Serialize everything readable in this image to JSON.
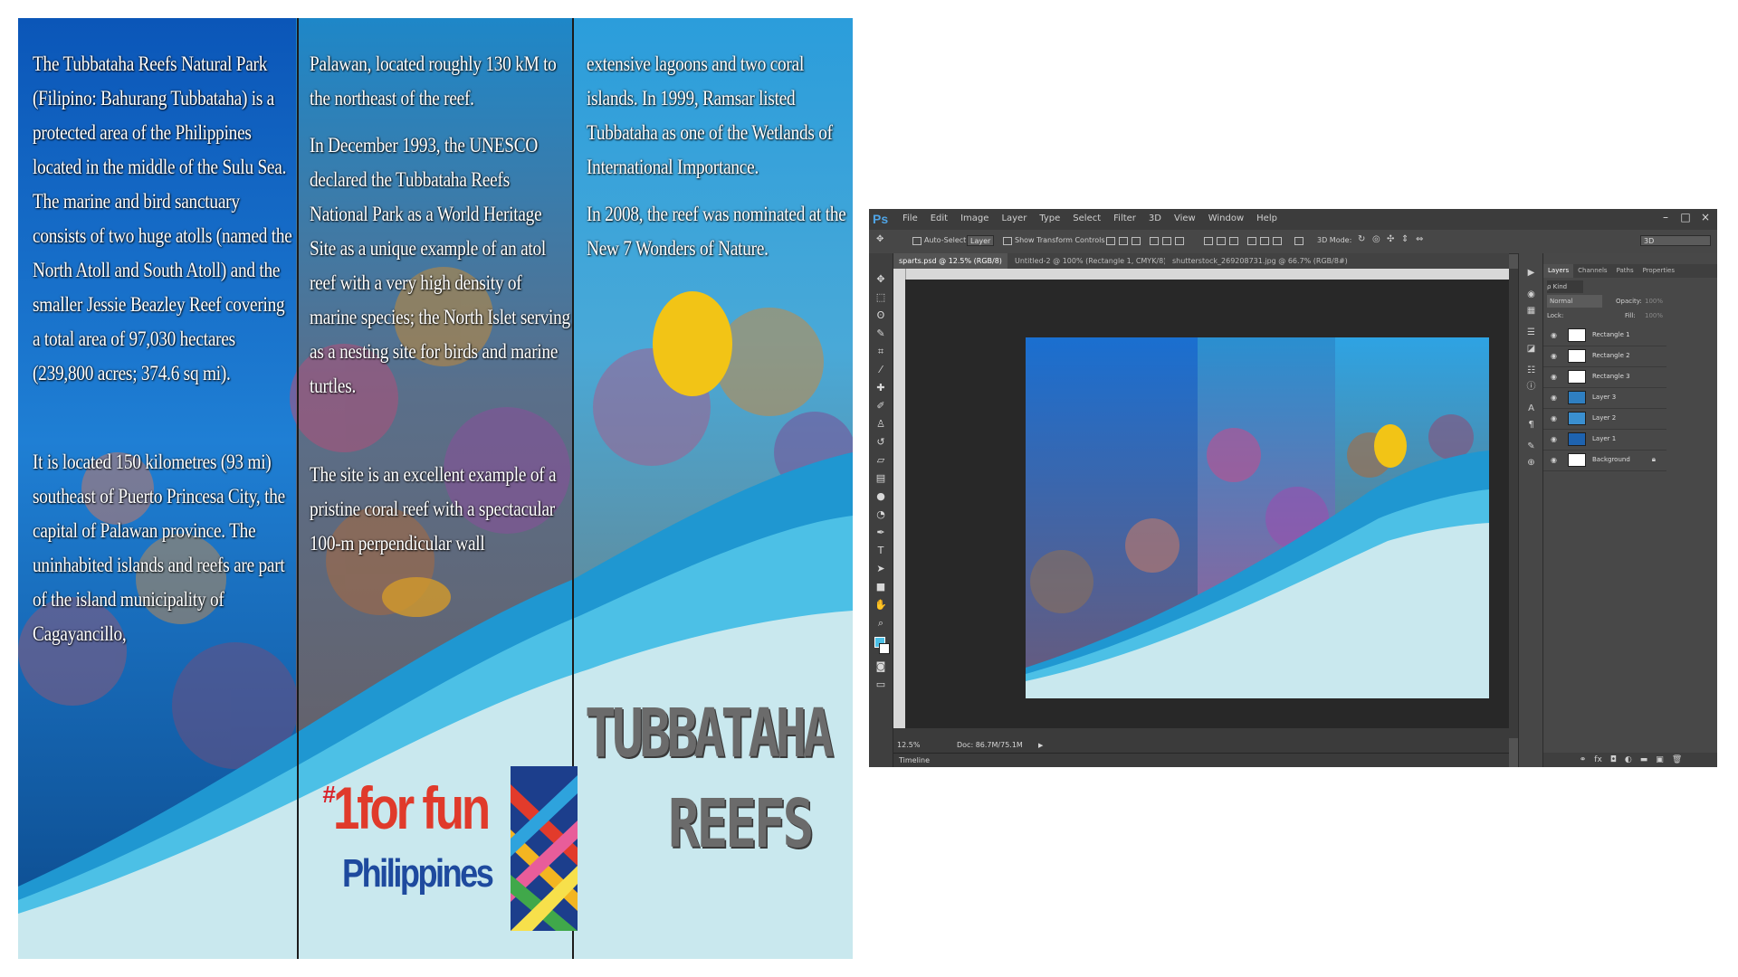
{
  "brochure": {
    "panel1": {
      "para1": "The Tubbataha Reefs Natural Park (Filipino: Bahurang Tubbataha) is a protected area of the Philippines located in the middle of the Sulu Sea. The marine and bird sanctuary consists of two huge atolls (named the North Atoll and South Atoll) and the smaller Jessie Beazley Reef covering a total area of 97,030 hectares (239,800 acres; 374.6 sq mi).",
      "para2": "It is located 150 kilometres (93 mi) southeast of Puerto Princesa City, the capital of Palawan province. The uninhabited islands and reefs are part of the island municipality of Cagayancillo,"
    },
    "panel2": {
      "para1": "Palawan, located roughly 130 kM to the northeast of the reef.",
      "para2": "In December 1993, the UNESCO declared the Tubbataha Reefs National Park as a World Heritage Site as a unique example of an atol reef with a very high density of marine species; the North Islet serving as a nesting site for birds and marine turtles.",
      "para3": "The site is an excellent example of a pristine coral reef with a spectacular 100-m perpendicular wall"
    },
    "panel3": {
      "para1": "extensive lagoons and two coral islands. In 1999, Ramsar listed Tubbataha as one of the Wetlands of International Importance.",
      "para2": "In 2008, the reef was nominated at the New 7 Wonders of Nature.",
      "title_line1": "TUBBATAHA",
      "title_line2": "REEFS"
    },
    "logo": {
      "hash": "#",
      "line1": "1for fun",
      "line2": "Philippines"
    }
  },
  "photoshop": {
    "app_logo": "Ps",
    "menu": [
      "File",
      "Edit",
      "Image",
      "Layer",
      "Type",
      "Select",
      "Filter",
      "3D",
      "View",
      "Window",
      "Help"
    ],
    "window_buttons": [
      "–",
      "□",
      "×"
    ],
    "options_bar": {
      "auto_select": "Auto-Select:",
      "auto_select_value": "Layer",
      "show_transform": "Show Transform Controls",
      "mode_3d": "3D Mode:",
      "workspace": "3D"
    },
    "tabs": [
      "sparts.psd @ 12.5% (RGB/8)",
      "Untitled-2 @ 100% (Rectangle 1, CMYK/8)",
      "shutterstock_269208731.jpg @ 66.7% (RGB/8#)"
    ],
    "status": {
      "zoom": "12.5%",
      "doc": "Doc: 86.7M/75.1M"
    },
    "timeline": "Timeline",
    "panel_tabs": [
      "Layers",
      "Channels",
      "Paths",
      "Properties"
    ],
    "kind_label": "ρ Kind",
    "blend_mode": "Normal",
    "opacity_label": "Opacity:",
    "opacity_value": "100%",
    "lock_label": "Lock:",
    "fill_label": "Fill:",
    "fill_value": "100%",
    "layers": [
      {
        "name": "Rectangle 1",
        "thumb": "#ffffff"
      },
      {
        "name": "Rectangle 2",
        "thumb": "#ffffff"
      },
      {
        "name": "Rectangle 3",
        "thumb": "#ffffff"
      },
      {
        "name": "Layer 3",
        "thumb": "#2f7fc1"
      },
      {
        "name": "Layer 2",
        "thumb": "#3a8fd0"
      },
      {
        "name": "Layer 1",
        "thumb": "#1e63b0"
      },
      {
        "name": "Background",
        "thumb": "#ffffff"
      }
    ]
  },
  "colors": {
    "wave_dark": "#1f97d1",
    "wave_mid": "#4cc0e6",
    "wave_light": "#c9e8ee",
    "ps_accent": "#4fa4e6"
  }
}
